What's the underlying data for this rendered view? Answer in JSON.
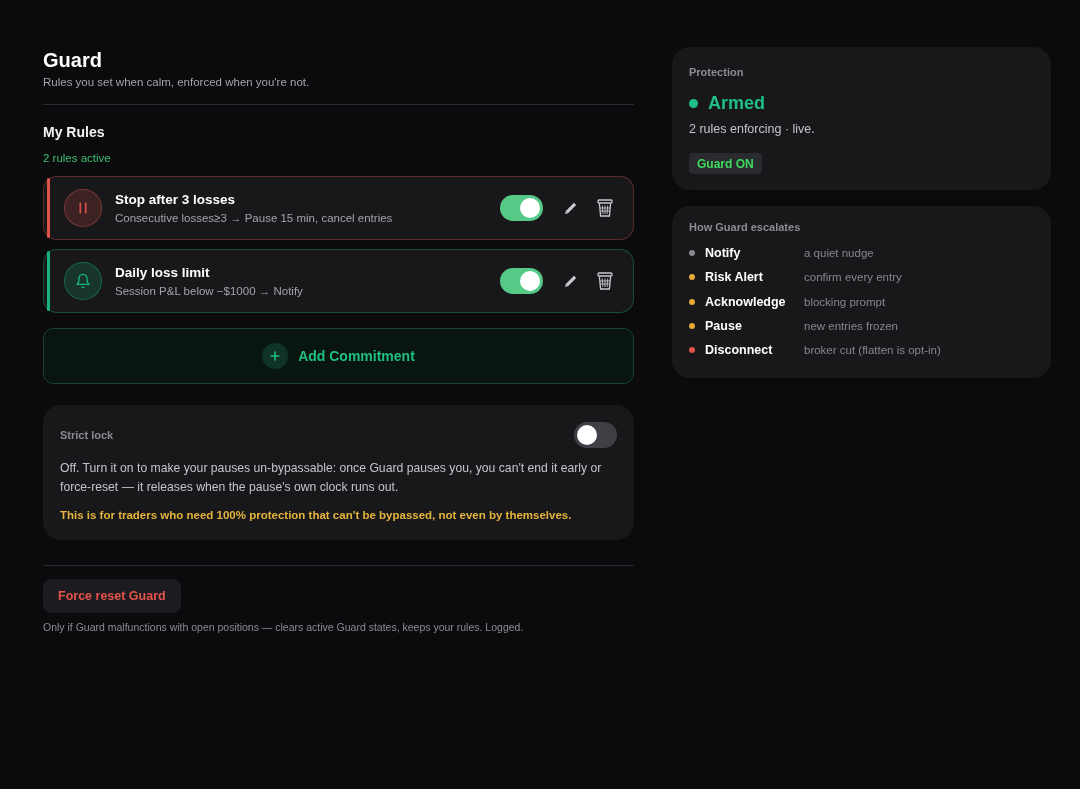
{
  "header": {
    "title": "Guard",
    "subtitle": "Rules you set when calm, enforced when you're not."
  },
  "rules_section": {
    "title": "My Rules",
    "count": "2 rules active",
    "rules": [
      {
        "kind": "pause",
        "title": "Stop after 3 losses",
        "detail": "Consecutive losses≥3 → Pause 15 min, cancel entries",
        "color": "#e0524a",
        "on": true
      },
      {
        "kind": "notify",
        "title": "Daily loss limit",
        "detail": "Session P&L below −$1000 → Notify",
        "color": "#17b57c",
        "on": true
      }
    ],
    "add_button": "Add Commitment"
  },
  "strict_lock": {
    "label": "Strict lock",
    "on": false,
    "description": "Off. Turn it on to make your pauses un-bypassable: once Guard pauses you, you can't end it early or force-reset — it releases when the pause's own clock runs out.",
    "warning": "This is for traders who need 100% protection that can't be bypassed, not even by themselves."
  },
  "force_reset": {
    "button": "Force reset Guard",
    "note": "Only if Guard malfunctions with open positions — clears active Guard states, keeps your rules. Logged."
  },
  "protection": {
    "label": "Protection",
    "status": "Armed",
    "detail": "2 rules enforcing · live.",
    "badge": "Guard ON"
  },
  "escalation": {
    "title": "How Guard escalates",
    "levels": [
      {
        "name": "Notify",
        "description": "a quiet nudge",
        "color": "#8a8a90"
      },
      {
        "name": "Risk Alert",
        "description": "confirm every entry",
        "color": "#e8a93a"
      },
      {
        "name": "Acknowledge",
        "description": "blocking prompt",
        "color": "#e8a93a"
      },
      {
        "name": "Pause",
        "description": "new entries frozen",
        "color": "#e8a93a"
      },
      {
        "name": "Disconnect",
        "description": "broker cut (flatten is opt-in)",
        "color": "#e0524a"
      }
    ]
  }
}
